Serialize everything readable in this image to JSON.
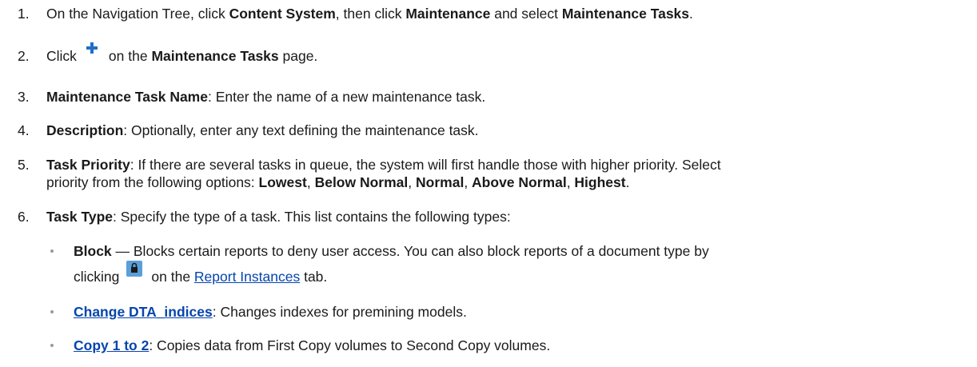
{
  "steps": [
    {
      "num": "1.",
      "t1": "On the Navigation Tree, click ",
      "b1": "Content System",
      "t2": ", then click ",
      "b2": "Maintenance",
      "t3": " and select ",
      "b3": "Maintenance Tasks",
      "t4": "."
    },
    {
      "num": "2.",
      "t1": "Click",
      "icon": "plus-icon",
      "t2": "on the ",
      "b1": "Maintenance Tasks",
      "t3": " page."
    },
    {
      "num": "3.",
      "b1": "Maintenance Task Name",
      "t1": ": Enter the name of a new maintenance task."
    },
    {
      "num": "4.",
      "b1": "Description",
      "t1": ": Optionally, enter any text defining the maintenance task."
    },
    {
      "num": "5.",
      "b1": "Task Priority",
      "t1": ": If there are several tasks in queue, the system will first handle those with higher priority. Select",
      "t2": "priority from the following options: ",
      "o1": "Lowest",
      "o2": "Below Normal",
      "o3": "Normal",
      "o4": "Above Normal",
      "o5": "Highest",
      "sep": ", ",
      "end": "."
    },
    {
      "num": "6.",
      "b1": "Task Type",
      "t1": ": Specify the type of a task. This list contains the following types:"
    }
  ],
  "bullets": [
    {
      "b1": "Block",
      "t1": " — Blocks certain reports to deny user access. You can also block reports of a document type by",
      "t2": "clicking",
      "icon": "lock-icon",
      "t3": "on the ",
      "link": "Report Instances",
      "t4": " tab."
    },
    {
      "link": "Change DTA_indices",
      "t1": ": Changes indexes for premining models."
    },
    {
      "link": "Copy 1 to 2",
      "t1": ": Copies data from First Copy volumes to Second Copy volumes."
    }
  ],
  "colors": {
    "link": "#0645ad",
    "plus_icon": "#1f6fc8",
    "lock_icon_bg": "#5a9fd8",
    "bullet": "#9a9a9a"
  }
}
